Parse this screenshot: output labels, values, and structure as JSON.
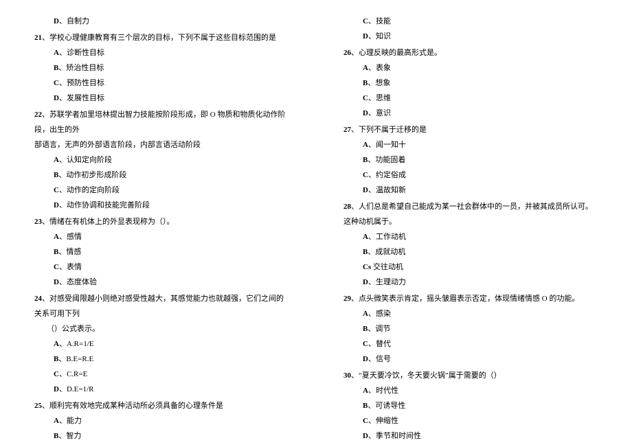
{
  "leftColumn": {
    "orphanOption": {
      "letter": "D",
      "text": "自制力"
    },
    "q21": {
      "num": "21",
      "text": "、学校心理健康教育有三个层次的目标，下列不属于这些目标范围的是",
      "options": [
        {
          "letter": "A",
          "text": "诊断性目标"
        },
        {
          "letter": "B",
          "text": "矫治性目标"
        },
        {
          "letter": "C",
          "text": "预防性目标"
        },
        {
          "letter": "D",
          "text": "发展性目标"
        }
      ]
    },
    "q22": {
      "num": "22",
      "text1": "、苏联学者加里培林提出智力技能按阶段形成，即 O 物质和物质化动作阶段，出生的外",
      "text2": "部语言，无声的外部语言阶段，内部言语活动阶段",
      "options": [
        {
          "letter": "A",
          "text": "认知定向阶段"
        },
        {
          "letter": "B",
          "text": "动作初步形成阶段"
        },
        {
          "letter": "C",
          "text": "动作的定向阶段"
        },
        {
          "letter": "D",
          "text": "动作协调和技能完善阶段"
        }
      ]
    },
    "q23": {
      "num": "23",
      "text": "、情绪在有机体上的外显表现称为（）。",
      "options": [
        {
          "letter": "A",
          "text": "感情"
        },
        {
          "letter": "B",
          "text": "情感"
        },
        {
          "letter": "C",
          "text": "表情"
        },
        {
          "letter": "D",
          "text": "态度体验"
        }
      ]
    },
    "q24": {
      "num": "24",
      "text1": "、对感受阈限越小则绝对感受性越大，其感觉能力也就越强，它们之间的关系可用下列",
      "text2": "（）公式表示。",
      "options": [
        {
          "letter": "A",
          "text": "A.R=1/E"
        },
        {
          "letter": "B",
          "text": "B.E=R.E"
        },
        {
          "letter": "C",
          "text": "C.R=E"
        },
        {
          "letter": "D",
          "text": "D.E=1/R"
        }
      ]
    },
    "q25": {
      "num": "25",
      "text": "、顺利完有效地完成某种活动所必须具备的心理条件是",
      "options": [
        {
          "letter": "A",
          "text": "能力"
        },
        {
          "letter": "B",
          "text": "智力"
        }
      ]
    }
  },
  "rightColumn": {
    "orphanOptions": [
      {
        "letter": "C",
        "text": "技能"
      },
      {
        "letter": "D",
        "text": "知识"
      }
    ],
    "q26": {
      "num": "26",
      "text": "、心理反映的最高形式是。",
      "options": [
        {
          "letter": "A",
          "text": "表象"
        },
        {
          "letter": "B",
          "text": "想象"
        },
        {
          "letter": "C",
          "text": "思维"
        },
        {
          "letter": "D",
          "text": "意识"
        }
      ]
    },
    "q27": {
      "num": "27",
      "text": "、下列不属于迁移的是",
      "options": [
        {
          "letter": "A",
          "text": "闻一知十"
        },
        {
          "letter": "B",
          "text": "功能固着"
        },
        {
          "letter": "C",
          "text": "约定俗成"
        },
        {
          "letter": "D",
          "text": "温故知新"
        }
      ]
    },
    "q28": {
      "num": "28",
      "text": "、人们总是希望自己能成为某一社会群体中的一员，并被其成员所认可。这种动机属于。",
      "options": [
        {
          "letter": "A",
          "text": "工作动机"
        },
        {
          "letter": "B",
          "text": "成就动机"
        },
        {
          "letter": "Cs",
          "text": "交往动机"
        },
        {
          "letter": "D",
          "text": "生理动力"
        }
      ]
    },
    "q29": {
      "num": "29",
      "text": "、点头微笑表示肯定，摇头皱眉表示否定，体现情绪情感 O 的功能。",
      "options": [
        {
          "letter": "A",
          "text": "感染"
        },
        {
          "letter": "B",
          "text": "调节"
        },
        {
          "letter": "C",
          "text": "替代"
        },
        {
          "letter": "D",
          "text": "信号"
        }
      ]
    },
    "q30": {
      "num": "30",
      "text": "、“夏天要冷饮，冬天要火锅”属于需要的（）",
      "options": [
        {
          "letter": "A",
          "text": "时代性"
        },
        {
          "letter": "B",
          "text": "可诱导性"
        },
        {
          "letter": "C",
          "text": "伸缩性"
        },
        {
          "letter": "D",
          "text": "季节和时间性"
        }
      ]
    }
  }
}
